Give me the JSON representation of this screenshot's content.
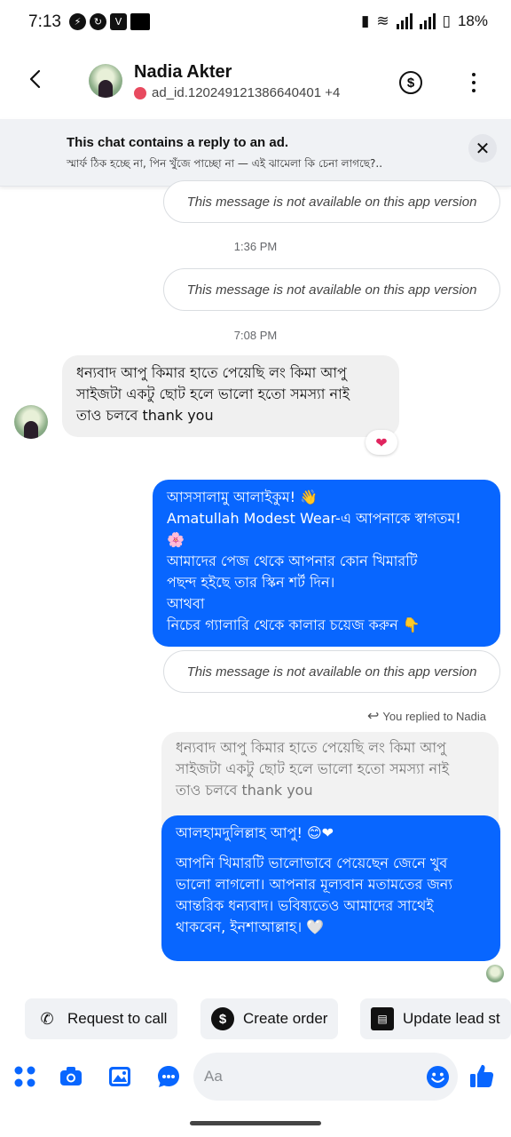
{
  "status_bar": {
    "time": "7:13",
    "battery": "18%"
  },
  "header": {
    "name": "Nadia Akter",
    "subtitle": "ad_id.120249121386640401 +4"
  },
  "banner": {
    "title": "This chat contains a reply to an ad.",
    "text": "স্মার্ফ ঠিক হচ্ছে না, পিন খুঁজে পাচ্ছো না — এই ঝামেলা কি চেনা লাগছে?.."
  },
  "messages": {
    "unavailable": "This message is not available on this app version",
    "time_1": "1:36 PM",
    "time_2": "7:08 PM",
    "incoming_1": [
      "ধন্যবাদ আপু কিমার হাতে পেয়েছি লং কিমা আপু",
      "সাইজটা একটু ছোট হলে ভালো হতো সমস্যা নাই",
      "তাও চলবে thank you"
    ],
    "reaction": "❤",
    "outgoing_1": [
      "আসসালামু আলাইকুম! 👋",
      "Amatullah Modest Wear-এ আপনাকে স্বাগতম!",
      "🌸",
      "আমাদের পেজ থেকে আপনার কোন খিমারটি",
      "পছন্দ হইছে তার স্কিন শর্ট দিন।",
      "আথবা",
      "নিচের গ্যালারি থেকে কালার চয়েজ করুন 👇"
    ],
    "replied_label": "You replied to Nadia",
    "quoted": [
      "ধন্যবাদ আপু কিমার হাতে পেয়েছি লং কিমা আপু",
      "সাইজটা একটু ছোট হলে ভালো হতো সমস্যা নাই",
      "তাও চলবে thank you"
    ],
    "outgoing_2": [
      "আলহামদুলিল্লাহ আপু! 😊❤",
      "",
      "আপনি খিমারটি ভালোভাবে পেয়েছেন জেনে খুব",
      "ভালো লাগলো। আপনার মূল্যবান মতামতের জন্য",
      "আন্তরিক ধন্যবাদ।  ভবিষ্যতেও আমাদের সাথেই",
      "থাকবেন, ইনশাআল্লাহ। 🤍"
    ]
  },
  "actions": {
    "request_call": "Request to call",
    "create_order": "Create order",
    "update_lead": "Update lead st"
  },
  "composer": {
    "placeholder": "Aa"
  },
  "colors": {
    "accent": "#0866ff",
    "bubble_in": "#f0f0f0"
  }
}
